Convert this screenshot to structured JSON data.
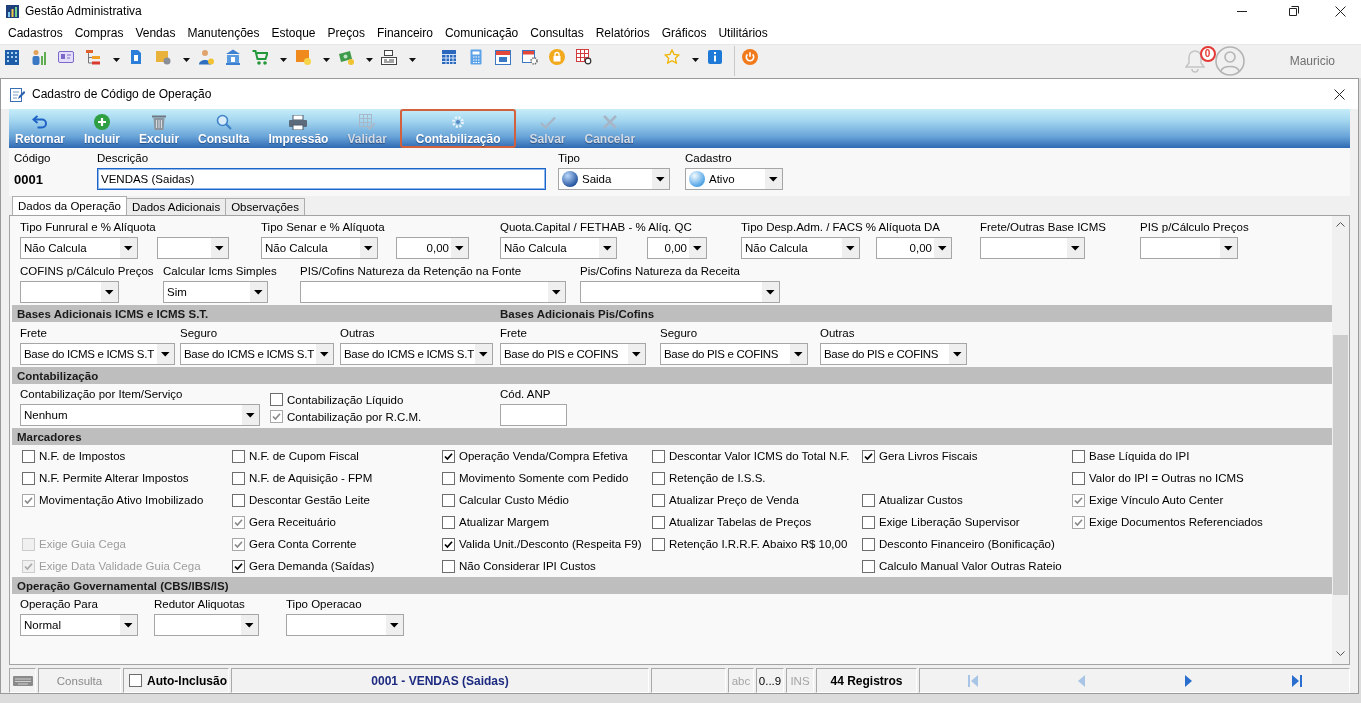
{
  "window": {
    "title": "Gestão Administrativa"
  },
  "menu": [
    "Cadastros",
    "Compras",
    "Vendas",
    "Manutenções",
    "Estoque",
    "Preços",
    "Financeiro",
    "Comunicação",
    "Consultas",
    "Relatórios",
    "Gráficos",
    "Utilitários"
  ],
  "user": {
    "notifications": "0",
    "name": "Mauricio"
  },
  "child_window": {
    "title": "Cadastro de Código de Operação"
  },
  "toolbar": [
    {
      "label": "Retornar",
      "kind": "back",
      "disabled": false,
      "highlighted": false
    },
    {
      "label": "Incluir",
      "kind": "add",
      "disabled": false,
      "highlighted": false
    },
    {
      "label": "Excluir",
      "kind": "delete",
      "disabled": false,
      "highlighted": false
    },
    {
      "label": "Consulta",
      "kind": "search",
      "disabled": false,
      "highlighted": false
    },
    {
      "label": "Impressão",
      "kind": "print",
      "disabled": false,
      "highlighted": false
    },
    {
      "label": "Validar",
      "kind": "validate",
      "disabled": true,
      "highlighted": false
    },
    {
      "label": "Contabilização",
      "kind": "accounting",
      "disabled": false,
      "highlighted": true
    },
    {
      "label": "Salvar",
      "kind": "save",
      "disabled": true,
      "highlighted": false
    },
    {
      "label": "Cancelar",
      "kind": "cancel",
      "disabled": true,
      "highlighted": false
    }
  ],
  "header": {
    "code": {
      "label": "Código",
      "value": "0001"
    },
    "description": {
      "label": "Descrição",
      "value": "VENDAS (Saidas)",
      "focused": true
    },
    "type": {
      "label": "Tipo",
      "value": "Saida"
    },
    "status": {
      "label": "Cadastro",
      "value": "Ativo"
    }
  },
  "tabs": [
    {
      "label": "Dados da Operação",
      "selected": true
    },
    {
      "label": "Dados Adicionais",
      "selected": false
    },
    {
      "label": "Observações",
      "selected": false
    }
  ],
  "fiscal_rows": [
    [
      {
        "label": "Tipo Funrural e % Alíquota",
        "controls": [
          {
            "kind": "select",
            "value": "Não Calcula"
          },
          {
            "kind": "select"
          }
        ]
      },
      {
        "label": "Tipo Senar e % Alíquota",
        "controls": [
          {
            "kind": "select",
            "value": "Não Calcula"
          },
          {
            "kind": "number",
            "value": "0,00"
          }
        ]
      },
      {
        "label": "Quota.Capital / FETHAB - % Alíq. QC",
        "controls": [
          {
            "kind": "select",
            "value": "Não Calcula"
          },
          {
            "kind": "number",
            "value": "0,00"
          }
        ]
      },
      {
        "label": "Tipo Desp.Adm. / FACS % Alíquota DA",
        "controls": [
          {
            "kind": "select",
            "value": "Não Calcula"
          },
          {
            "kind": "number",
            "value": "0,00"
          }
        ]
      },
      {
        "label": "Frete/Outras Base ICMS",
        "controls": [
          {
            "kind": "select"
          }
        ]
      },
      {
        "label": "PIS p/Cálculo Preços",
        "controls": [
          {
            "kind": "select"
          }
        ]
      }
    ],
    [
      {
        "label": "COFINS p/Cálculo Preços",
        "controls": [
          {
            "kind": "select"
          }
        ]
      },
      {
        "label": "Calcular Icms Simples",
        "controls": [
          {
            "kind": "select",
            "value": "Sim"
          }
        ]
      },
      {
        "label": "PIS/Cofins Natureza da Retenção na Fonte",
        "controls": [
          {
            "kind": "select"
          }
        ]
      },
      {
        "label": "Pis/Cofins Natureza da Receita",
        "controls": [
          {
            "kind": "select"
          }
        ]
      }
    ]
  ],
  "bases": {
    "titles": [
      "Bases Adicionais ICMS e ICMS S.T.",
      "Bases Adicionais Pis/Cofins"
    ],
    "fields": [
      {
        "label": "Frete",
        "value": "Base do ICMS e ICMS S.T"
      },
      {
        "label": "Seguro",
        "value": "Base do ICMS e ICMS S.T"
      },
      {
        "label": "Outras",
        "value": "Base do ICMS e ICMS S.T"
      },
      {
        "label": "Frete",
        "value": "Base do PIS e COFINS"
      },
      {
        "label": "Seguro",
        "value": "Base do PIS e COFINS"
      },
      {
        "label": "Outras",
        "value": "Base do PIS e COFINS"
      }
    ]
  },
  "contabilizacao": {
    "title": "Contabilização",
    "item_field": {
      "label": "Contabilização por Item/Serviço",
      "value": "Nenhum"
    },
    "checks": [
      {
        "label": "Contabilização Líquido",
        "checked": false,
        "readonly": false
      },
      {
        "label": "Contabilização por R.C.M.",
        "checked": true,
        "readonly": true
      }
    ],
    "anp": {
      "label": "Cód. ANP"
    }
  },
  "marcadores": {
    "title": "Marcadores",
    "columns": [
      [
        {
          "label": "N.F. de Impostos",
          "checked": false,
          "readonly": false,
          "disabled": false
        },
        {
          "label": "N.F. Permite Alterar Impostos",
          "checked": false,
          "readonly": false,
          "disabled": false
        },
        {
          "label": "Movimentação Ativo Imobilizado",
          "checked": true,
          "readonly": true,
          "disabled": false
        },
        null,
        {
          "label": "Exige Guia Cega",
          "checked": false,
          "readonly": false,
          "disabled": true
        },
        {
          "label": "Exige Data Validade Guia Cega",
          "checked": true,
          "readonly": false,
          "disabled": true
        }
      ],
      [
        {
          "label": "N.F. de Cupom Fiscal",
          "checked": false,
          "readonly": false,
          "disabled": false
        },
        {
          "label": "N.F. de Aquisição - FPM",
          "checked": false,
          "readonly": false,
          "disabled": false
        },
        {
          "label": "Descontar Gestão Leite",
          "checked": false,
          "readonly": false,
          "disabled": false
        },
        {
          "label": "Gera Receituário",
          "checked": true,
          "readonly": true,
          "disabled": false
        },
        {
          "label": "Gera Conta Corrente",
          "checked": true,
          "readonly": true,
          "disabled": false
        },
        {
          "label": "Gera Demanda (Saídas)",
          "checked": true,
          "readonly": false,
          "disabled": false
        }
      ],
      [
        {
          "label": "Operação Venda/Compra Efetiva",
          "checked": true,
          "readonly": false,
          "disabled": false
        },
        {
          "label": "Movimento Somente com Pedido",
          "checked": false,
          "readonly": false,
          "disabled": false
        },
        {
          "label": "Calcular Custo Médio",
          "checked": false,
          "readonly": false,
          "disabled": false
        },
        {
          "label": "Atualizar Margem",
          "checked": false,
          "readonly": false,
          "disabled": false
        },
        {
          "label": "Valida Unit./Desconto (Respeita F9)",
          "checked": true,
          "readonly": false,
          "disabled": false
        },
        {
          "label": "Não Considerar IPI Custos",
          "checked": false,
          "readonly": false,
          "disabled": false
        }
      ],
      [
        {
          "label": "Descontar Valor ICMS do Total N.F.",
          "checked": false,
          "readonly": false,
          "disabled": false
        },
        {
          "label": "Retenção de I.S.S.",
          "checked": false,
          "readonly": false,
          "disabled": false
        },
        {
          "label": "Atualizar Preço de Venda",
          "checked": false,
          "readonly": false,
          "disabled": false
        },
        {
          "label": "Atualizar Tabelas de Preços",
          "checked": false,
          "readonly": false,
          "disabled": false
        },
        {
          "label": "Retenção I.R.R.F. Abaixo R$ 10,00",
          "checked": false,
          "readonly": false,
          "disabled": false
        }
      ],
      [
        {
          "label": "Gera Livros Fiscais",
          "checked": true,
          "readonly": false,
          "disabled": false
        },
        null,
        {
          "label": "Atualizar Custos",
          "checked": false,
          "readonly": false,
          "disabled": false
        },
        {
          "label": "Exige Liberação Supervisor",
          "checked": false,
          "readonly": false,
          "disabled": false
        },
        {
          "label": "Desconto Financeiro (Bonificação)",
          "checked": false,
          "readonly": false,
          "disabled": false
        },
        {
          "label": "Calculo Manual Valor Outras Rateio",
          "checked": false,
          "readonly": false,
          "disabled": false
        }
      ],
      [
        {
          "label": "Base Líquida do IPI",
          "checked": false,
          "readonly": false,
          "disabled": false
        },
        {
          "label": "Valor do IPI = Outras no ICMS",
          "checked": false,
          "readonly": false,
          "disabled": false
        },
        {
          "label": "Exige Vínculo Auto Center",
          "checked": true,
          "readonly": true,
          "disabled": false
        },
        {
          "label": "Exige Documentos Referenciados",
          "checked": true,
          "readonly": true,
          "disabled": false
        }
      ]
    ]
  },
  "governamental": {
    "title": "Operação Governamental (CBS/IBS/IS)",
    "fields": [
      {
        "label": "Operação Para",
        "value": "Normal"
      },
      {
        "label": "Redutor Aliquotas"
      },
      {
        "label": "Tipo Operacao"
      }
    ]
  },
  "status_bar": {
    "mode": "Consulta",
    "auto_inclusion": {
      "label": "Auto-Inclusão",
      "checked": false
    },
    "record": "0001 - VENDAS (Saidas)",
    "indicators": [
      {
        "label": "abc",
        "active": false
      },
      {
        "label": "0...9",
        "active": true
      },
      {
        "label": "INS",
        "active": false
      }
    ],
    "count": "44 Registros",
    "navigation": [
      {
        "kind": "first",
        "disabled": true
      },
      {
        "kind": "previous",
        "disabled": true
      },
      {
        "kind": "next",
        "disabled": false
      },
      {
        "kind": "last",
        "disabled": false
      }
    ]
  }
}
